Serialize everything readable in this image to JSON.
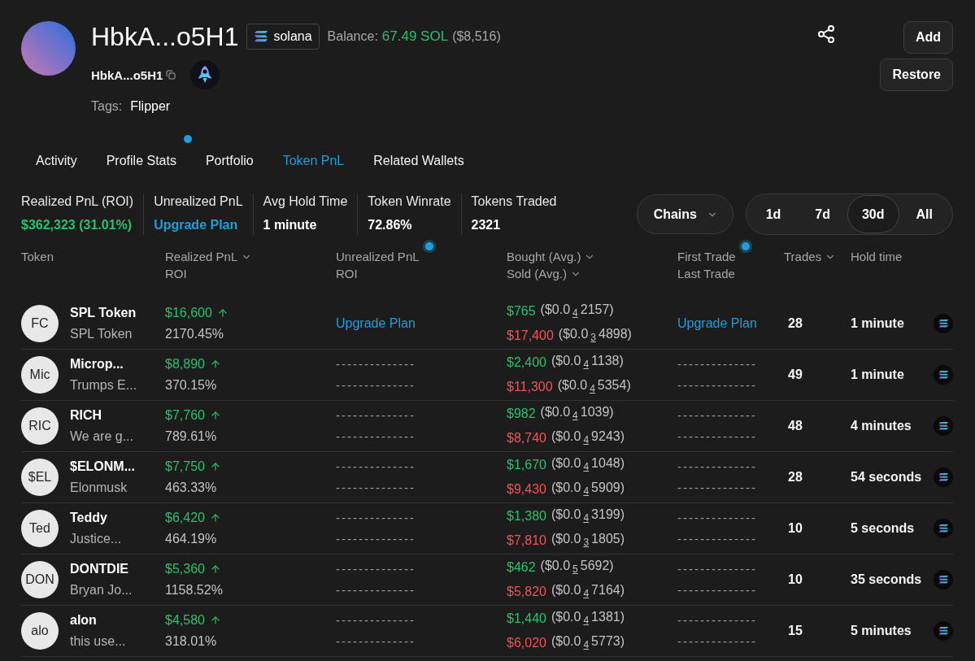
{
  "profile": {
    "title": "HbkA...o5H1",
    "chain": "solana",
    "balance_label": "Balance:",
    "balance_value": "67.49 SOL",
    "balance_usd": "($8,516)",
    "address": "HbkA...o5H1",
    "tags_label": "Tags:",
    "tags": [
      "Flipper"
    ]
  },
  "buttons": [
    "Add",
    "Restore"
  ],
  "tabs": [
    {
      "label": "Activity",
      "selected": false,
      "dot": false
    },
    {
      "label": "Profile Stats",
      "selected": false,
      "dot": true
    },
    {
      "label": "Portfolio",
      "selected": false,
      "dot": false
    },
    {
      "label": "Token PnL",
      "selected": true,
      "dot": false
    },
    {
      "label": "Related Wallets",
      "selected": false,
      "dot": false
    }
  ],
  "stats": [
    {
      "label": "Realized PnL (ROI)",
      "value": "$362,323 (31.01%)",
      "kind": "gain"
    },
    {
      "label": "Unrealized PnL",
      "value": "Upgrade Plan",
      "kind": "upgrade"
    },
    {
      "label": "Avg Hold Time",
      "value": "1 minute",
      "kind": "plain"
    },
    {
      "label": "Token Winrate",
      "value": "72.86%",
      "kind": "plain"
    },
    {
      "label": "Tokens Traded",
      "value": "2321",
      "kind": "plain"
    }
  ],
  "chains_filter": "Chains",
  "periods": [
    {
      "label": "1d",
      "selected": false
    },
    {
      "label": "7d",
      "selected": false
    },
    {
      "label": "30d",
      "selected": true
    },
    {
      "label": "All",
      "selected": false
    }
  ],
  "table": {
    "columns": [
      {
        "lines": [
          {
            "text": "Token",
            "sortable": false
          }
        ],
        "dot": false
      },
      {
        "lines": [
          {
            "text": "Realized PnL",
            "sortable": true
          },
          {
            "text": "ROI",
            "sortable": false
          }
        ],
        "dot": false
      },
      {
        "lines": [
          {
            "text": "Unrealized PnL",
            "sortable": false
          },
          {
            "text": "ROI",
            "sortable": false
          }
        ],
        "dot": true
      },
      {
        "lines": [
          {
            "text": "Bought (Avg.)",
            "sortable": true
          },
          {
            "text": "Sold (Avg.)",
            "sortable": true
          }
        ],
        "dot": false
      },
      {
        "lines": [
          {
            "text": "First Trade",
            "sortable": false
          },
          {
            "text": "Last Trade",
            "sortable": false
          }
        ],
        "dot": true
      },
      {
        "lines": [
          {
            "text": "Trades",
            "sortable": true
          }
        ],
        "dot": false
      },
      {
        "lines": [
          {
            "text": "Hold time",
            "sortable": false
          }
        ],
        "dot": false
      }
    ],
    "rows": [
      {
        "initials": "FC",
        "name": "SPL Token",
        "subtitle": "SPL Token",
        "realized": "$16,600",
        "rising": true,
        "roi": "2170.45%",
        "unrealized": {
          "kind": "upgrade",
          "text": "Upgrade Plan"
        },
        "bought": "$765",
        "bought_avg": "($0.0$_{4}$2157)",
        "sold": "$17,400",
        "sold_avg": "($0.0$_{3}$4898)",
        "trade_dates": {
          "kind": "upgrade",
          "text": "Upgrade Plan"
        },
        "trades": "28",
        "hold_time": "1 minute"
      },
      {
        "initials": "Mic",
        "name": "Microp...",
        "subtitle": "Trumps E...",
        "realized": "$8,890",
        "rising": true,
        "roi": "370.15%",
        "unrealized": {
          "kind": "hidden",
          "lines": [
            "--------------",
            "--------------"
          ]
        },
        "bought": "$2,400",
        "bought_avg": "($0.0$_{4}$1138)",
        "sold": "$11,300",
        "sold_avg": "($0.0$_{4}$5354)",
        "trade_dates": {
          "kind": "hidden",
          "lines": [
            "--------------",
            "--------------"
          ]
        },
        "trades": "49",
        "hold_time": "1 minute"
      },
      {
        "initials": "RIC",
        "name": "RICH",
        "subtitle": "We are g...",
        "realized": "$7,760",
        "rising": true,
        "roi": "789.61%",
        "unrealized": {
          "kind": "hidden",
          "lines": [
            "--------------",
            "--------------"
          ]
        },
        "bought": "$982",
        "bought_avg": "($0.0$_{4}$1039)",
        "sold": "$8,740",
        "sold_avg": "($0.0$_{4}$9243)",
        "trade_dates": {
          "kind": "hidden",
          "lines": [
            "--------------",
            "--------------"
          ]
        },
        "trades": "48",
        "hold_time": "4 minutes"
      },
      {
        "initials": "$EL",
        "name": "$ELONM...",
        "subtitle": "Elonmusk",
        "realized": "$7,750",
        "rising": true,
        "roi": "463.33%",
        "unrealized": {
          "kind": "hidden",
          "lines": [
            "--------------",
            "--------------"
          ]
        },
        "bought": "$1,670",
        "bought_avg": "($0.0$_{4}$1048)",
        "sold": "$9,430",
        "sold_avg": "($0.0$_{4}$5909)",
        "trade_dates": {
          "kind": "hidden",
          "lines": [
            "--------------",
            "--------------"
          ]
        },
        "trades": "28",
        "hold_time": "54 seconds"
      },
      {
        "initials": "Ted",
        "name": "Teddy",
        "subtitle": "Justice...",
        "realized": "$6,420",
        "rising": true,
        "roi": "464.19%",
        "unrealized": {
          "kind": "hidden",
          "lines": [
            "--------------",
            "--------------"
          ]
        },
        "bought": "$1,380",
        "bought_avg": "($0.0$_{4}$3199)",
        "sold": "$7,810",
        "sold_avg": "($0.0$_{3}$1805)",
        "trade_dates": {
          "kind": "hidden",
          "lines": [
            "--------------",
            "--------------"
          ]
        },
        "trades": "10",
        "hold_time": "5 seconds"
      },
      {
        "initials": "DON",
        "name": "DONTDIE",
        "subtitle": "Bryan Jo...",
        "realized": "$5,360",
        "rising": true,
        "roi": "1158.52%",
        "unrealized": {
          "kind": "hidden",
          "lines": [
            "--------------",
            "--------------"
          ]
        },
        "bought": "$462",
        "bought_avg": "($0.0$_{5}$5692)",
        "sold": "$5,820",
        "sold_avg": "($0.0$_{4}$7164)",
        "trade_dates": {
          "kind": "hidden",
          "lines": [
            "--------------",
            "--------------"
          ]
        },
        "trades": "10",
        "hold_time": "35 seconds"
      },
      {
        "initials": "alo",
        "name": "alon",
        "subtitle": "this use...",
        "realized": "$4,580",
        "rising": true,
        "roi": "318.01%",
        "unrealized": {
          "kind": "hidden",
          "lines": [
            "--------------",
            "--------------"
          ]
        },
        "bought": "$1,440",
        "bought_avg": "($0.0$_{4}$1381)",
        "sold": "$6,020",
        "sold_avg": "($0.0$_{4}$5773)",
        "trade_dates": {
          "kind": "hidden",
          "lines": [
            "--------------",
            "--------------"
          ]
        },
        "trades": "15",
        "hold_time": "5 minutes"
      }
    ]
  }
}
